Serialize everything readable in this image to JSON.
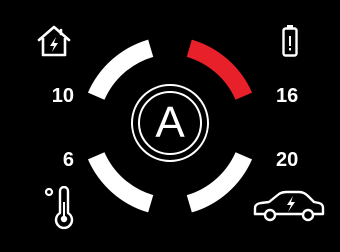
{
  "values": {
    "top_left": "10",
    "top_right": "16",
    "bottom_left": "6",
    "bottom_right": "20"
  },
  "mode": {
    "letter": "A"
  },
  "icons": {
    "top_left": "house-charging-icon",
    "top_right": "battery-icon",
    "bottom_left": "thermometer-degree-icon",
    "bottom_right": "electric-car-icon"
  },
  "colors": {
    "background": "#000000",
    "arc_default": "#ffffff",
    "arc_active": "#e8202a"
  },
  "arcs": {
    "top_left": "default",
    "top_right": "active",
    "bottom_left": "default",
    "bottom_right": "default"
  }
}
